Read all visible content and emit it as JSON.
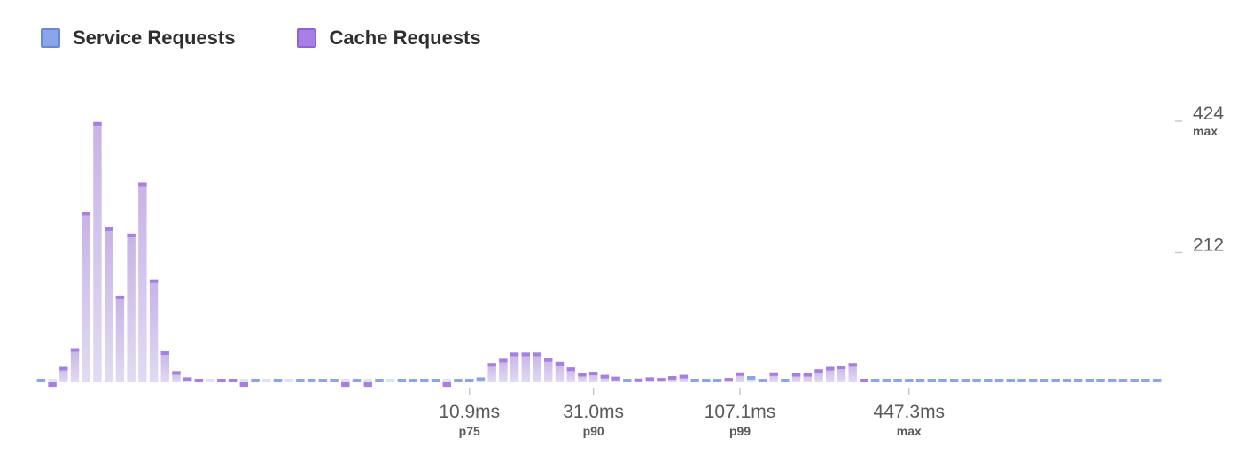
{
  "legend": [
    {
      "label": "Service Requests",
      "color": "#8aa6ea",
      "border": "#6f86d6"
    },
    {
      "label": "Cache Requests",
      "color": "#a77fe4",
      "border": "#8f63d8"
    }
  ],
  "colors": {
    "service_fill": "#dde2f5",
    "service_cap": "#8aa6ea",
    "cache_fill_top": "#c7b3e6",
    "cache_fill_bottom": "#e2dbf3",
    "cache_cap": "#a77fe4",
    "axis_text": "#5a5a5a",
    "tick_sub_text": "#5a5a5a",
    "tick_line": "#c8c8c8"
  },
  "chart_data": {
    "type": "bar",
    "stacked_diverging": true,
    "y_ticks": [
      {
        "value": 424,
        "label": "424",
        "sublabel": "max"
      },
      {
        "value": 212,
        "label": "212",
        "sublabel": ""
      }
    ],
    "ylim": [
      0,
      424
    ],
    "x_ticks": [
      {
        "bin": 38,
        "label": "10.9ms",
        "sublabel": "p75"
      },
      {
        "bin": 49,
        "label": "31.0ms",
        "sublabel": "p90"
      },
      {
        "bin": 62,
        "label": "107.1ms",
        "sublabel": "p99"
      },
      {
        "bin": 77,
        "label": "447.3ms",
        "sublabel": "max"
      }
    ],
    "series": [
      {
        "name": "Service Requests",
        "values": [
          2,
          0,
          0,
          0,
          0,
          0,
          0,
          0,
          0,
          0,
          0,
          0,
          0,
          0,
          0,
          0,
          0,
          0,
          0,
          2,
          0,
          2,
          0,
          2,
          3,
          3,
          3,
          3,
          1,
          0,
          1,
          0,
          1,
          3,
          3,
          1,
          2,
          1,
          3,
          8,
          9,
          10,
          10,
          10,
          10,
          9,
          7,
          6,
          5,
          5,
          4,
          3,
          3,
          2,
          4,
          3,
          4,
          4,
          2,
          2,
          2,
          1,
          8,
          10,
          4,
          4,
          3,
          3,
          3,
          3,
          3,
          3,
          3,
          3,
          3,
          3,
          3,
          3,
          3,
          3,
          3,
          3,
          3,
          3,
          3,
          3,
          3,
          3,
          3,
          3,
          3,
          3,
          3,
          3,
          3,
          3,
          3,
          3,
          3,
          3
        ],
        "cache": [
          0,
          -3,
          25,
          55,
          275,
          420,
          250,
          140,
          240,
          322,
          166,
          50,
          18,
          8,
          4,
          0,
          2,
          4,
          -3,
          0,
          0,
          0,
          0,
          0,
          0,
          0,
          0,
          -3,
          0,
          -3,
          0,
          0,
          0,
          0,
          0,
          0,
          -3,
          0,
          0,
          0,
          22,
          28,
          38,
          38,
          38,
          30,
          26,
          18,
          10,
          12,
          8,
          6,
          0,
          4,
          4,
          4,
          6,
          8,
          0,
          0,
          0,
          6,
          8,
          0,
          0,
          12,
          0,
          12,
          12,
          18,
          22,
          24,
          28,
          2,
          0,
          0,
          0,
          0,
          0,
          0,
          0,
          0,
          0,
          0,
          0,
          0,
          0,
          0,
          0,
          0,
          0,
          0,
          0,
          0,
          0,
          0,
          0,
          0,
          0,
          0
        ]
      }
    ]
  }
}
